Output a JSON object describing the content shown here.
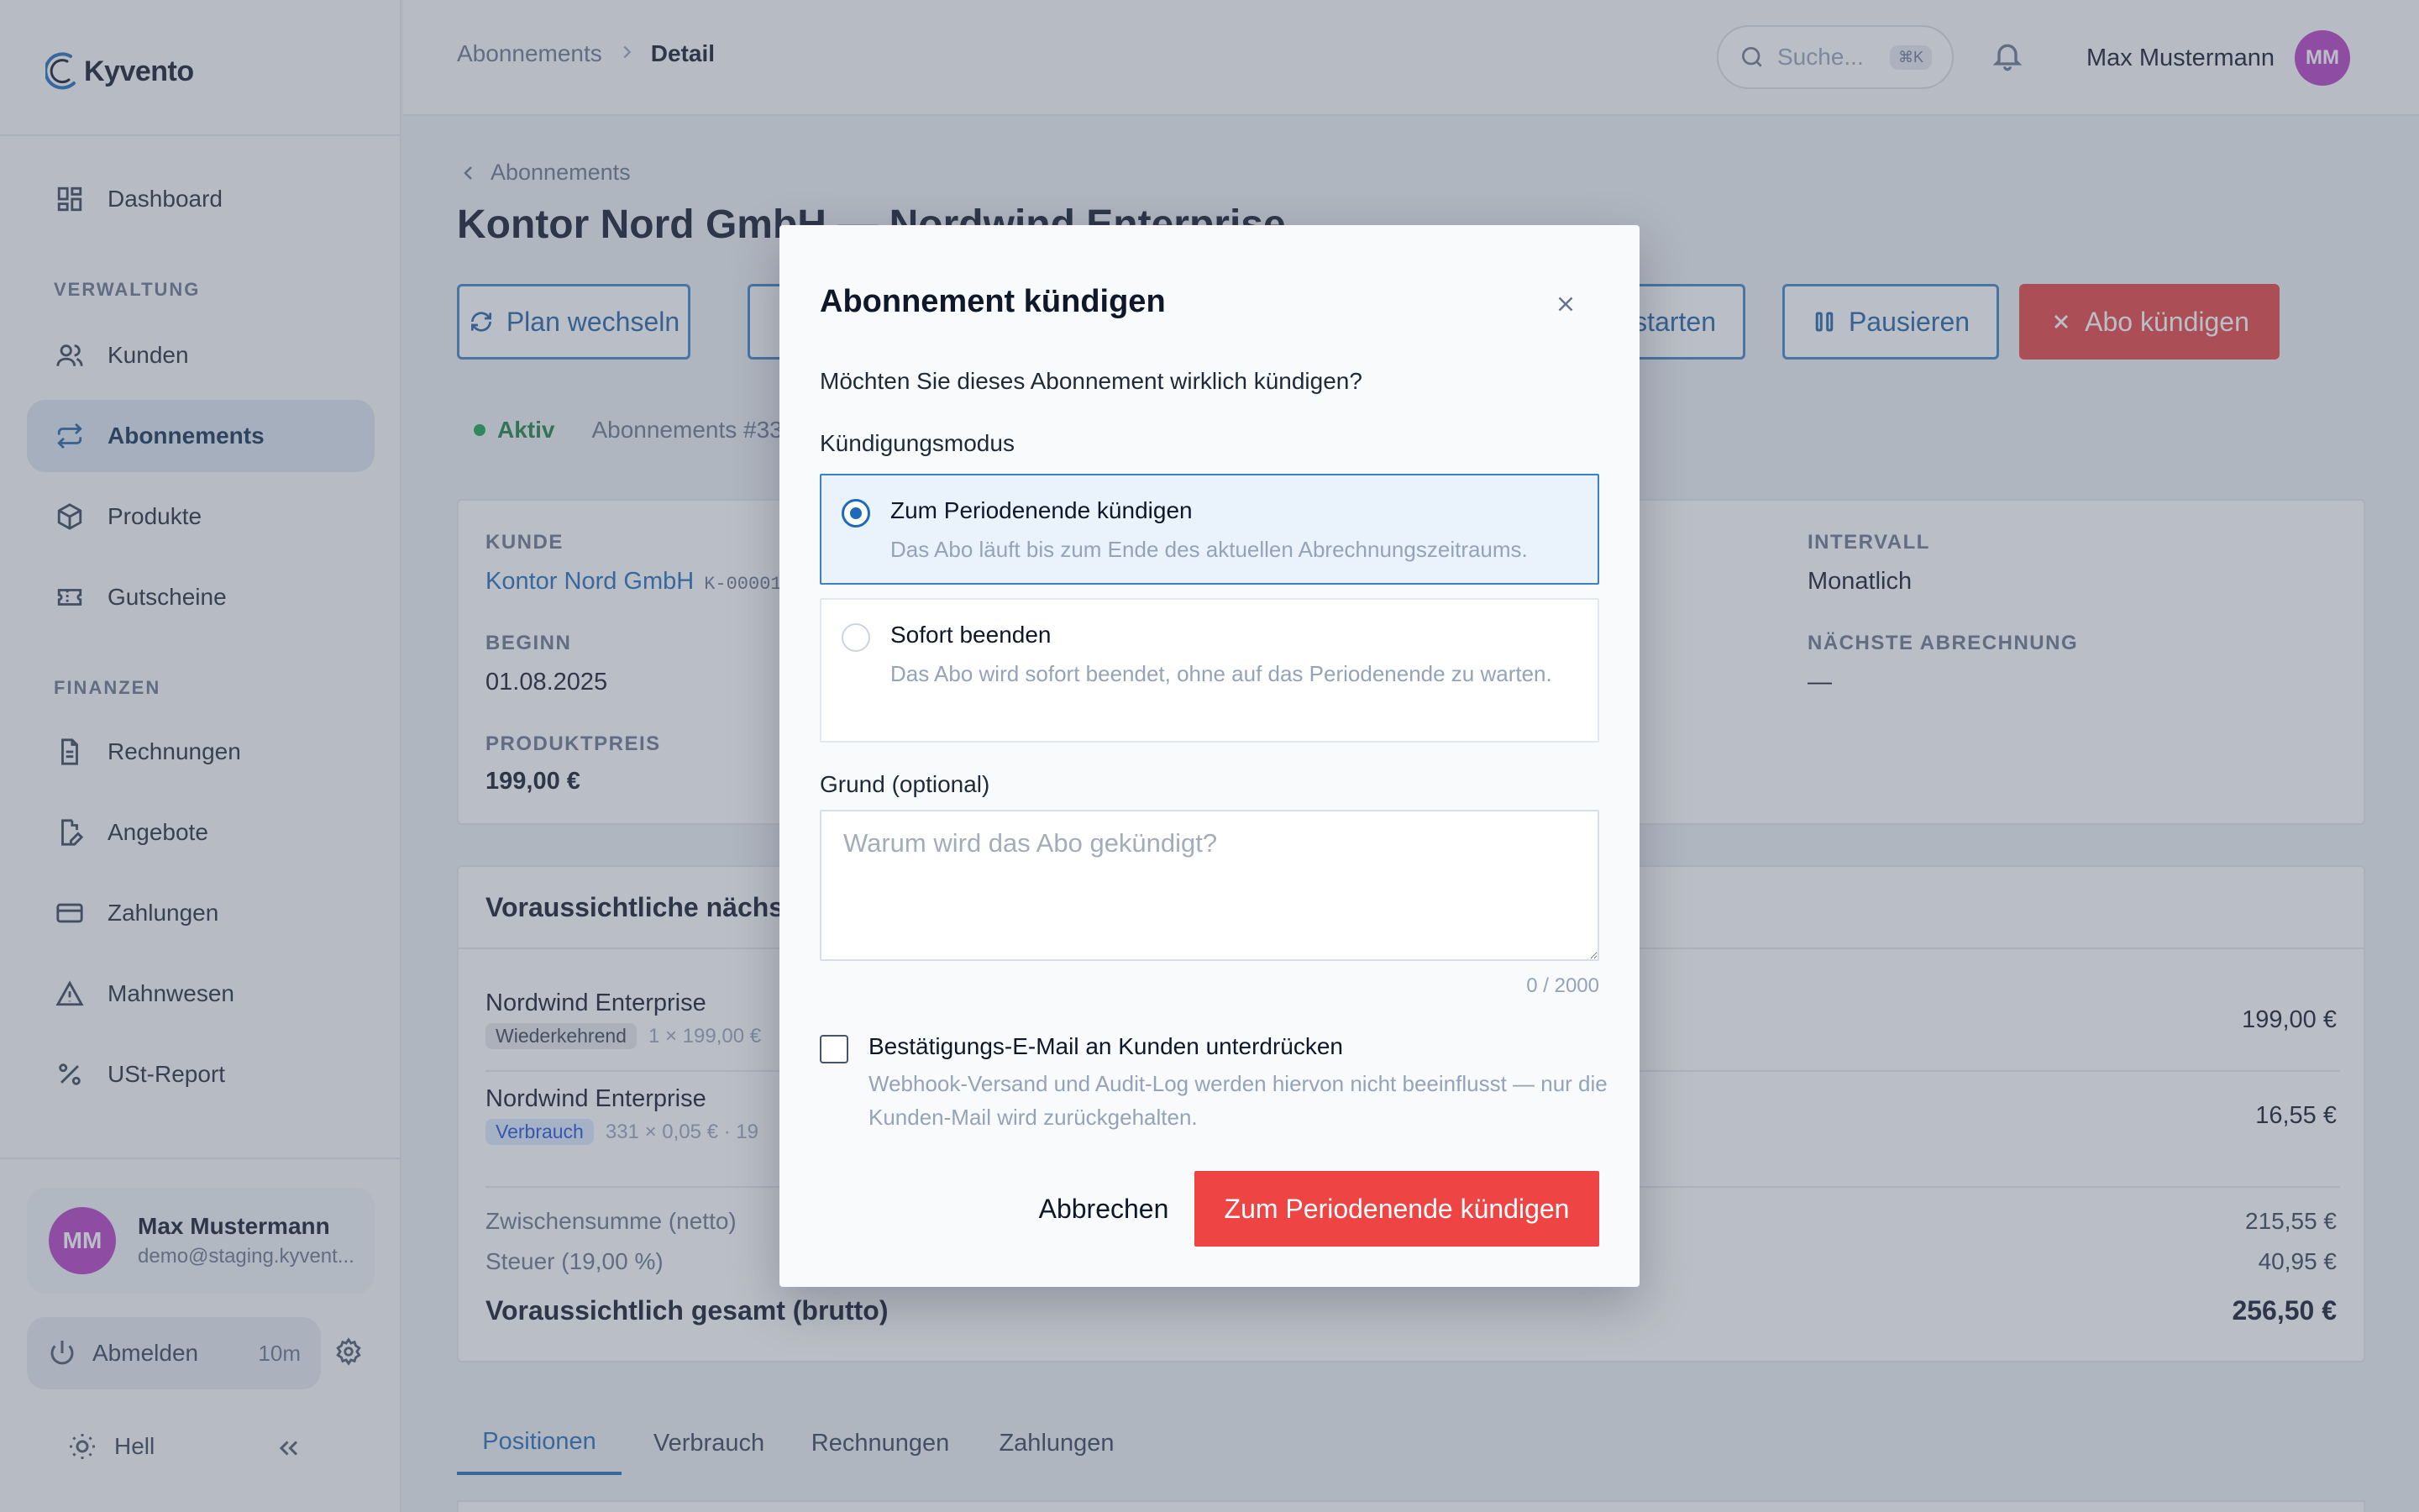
{
  "app": {
    "brand": "Kyvento",
    "colors": {
      "accent": "#1d6bb8",
      "danger": "#ef4444",
      "success": "#16a34a",
      "avatar": "#b43bc1"
    }
  },
  "sidebar": {
    "dashboard": "Dashboard",
    "section_verwaltung": "VERWALTUNG",
    "items_verwaltung": [
      {
        "label": "Kunden",
        "icon": "users-icon"
      },
      {
        "label": "Abonnements",
        "icon": "repeat-icon",
        "active": true
      },
      {
        "label": "Produkte",
        "icon": "box-icon"
      },
      {
        "label": "Gutscheine",
        "icon": "ticket-icon"
      }
    ],
    "section_finanzen": "FINANZEN",
    "items_finanzen": [
      {
        "label": "Rechnungen",
        "icon": "file-text-icon"
      },
      {
        "label": "Angebote",
        "icon": "file-edit-icon"
      },
      {
        "label": "Zahlungen",
        "icon": "credit-card-icon"
      },
      {
        "label": "Mahnwesen",
        "icon": "alert-triangle-icon"
      },
      {
        "label": "USt-Report",
        "icon": "percent-icon"
      }
    ],
    "user": {
      "initials": "MM",
      "name": "Max Mustermann",
      "email": "demo@staging.kyvent..."
    },
    "logout": {
      "label": "Abmelden",
      "time": "10m"
    },
    "theme": "Hell"
  },
  "topbar": {
    "breadcrumb": {
      "parent": "Abonnements",
      "current": "Detail"
    },
    "search": {
      "placeholder": "Suche...",
      "shortcut": "⌘K"
    },
    "user": {
      "name": "Max Mustermann",
      "initials": "MM"
    }
  },
  "main": {
    "back_label": "Abonnements",
    "title": "Kontor Nord GmbH — Nordwind Enterprise",
    "actions": {
      "plan_change": "Plan wechseln",
      "start": "starten",
      "pause": "Pausieren",
      "cancel": "Abo kündigen"
    },
    "status": {
      "label": "Aktiv",
      "id": "Abonnements #33"
    },
    "details": {
      "customer_label": "KUNDE",
      "customer_name": "Kontor Nord GmbH",
      "customer_id": "K-00001",
      "start_label": "BEGINN",
      "start_value": "01.08.2025",
      "price_label": "PRODUKTPREIS",
      "price_value": "199,00 €",
      "interval_label": "INTERVALL",
      "interval_value": "Monatlich",
      "next_billing_label": "NÄCHSTE ABRECHNUNG",
      "next_billing_value": "—"
    },
    "invoice_preview": {
      "heading": "Voraussichtliche nächst",
      "positions": [
        {
          "name": "Nordwind Enterprise",
          "tag": "Wiederkehrend",
          "meta": "1 × 199,00 €",
          "amount": "199,00 €"
        },
        {
          "name": "Nordwind Enterprise",
          "tag": "Verbrauch",
          "meta": "331 × 0,05 €  ·  19",
          "amount": "16,55 €"
        }
      ],
      "subtotal_label": "Zwischensumme (netto)",
      "subtotal_value": "215,55 €",
      "tax_label": "Steuer (19,00 %)",
      "tax_value": "40,95 €",
      "total_label": "Voraussichtlich gesamt (brutto)",
      "total_value": "256,50 €"
    },
    "tabs": [
      "Positionen",
      "Verbrauch",
      "Rechnungen",
      "Zahlungen"
    ]
  },
  "modal": {
    "title": "Abonnement kündigen",
    "question": "Möchten Sie dieses Abonnement wirklich kündigen?",
    "mode_label": "Kündigungsmodus",
    "option_period": {
      "title": "Zum Periodenende kündigen",
      "desc": "Das Abo läuft bis zum Ende des aktuellen Abrechnungszeitraums.",
      "selected": true
    },
    "option_immediate": {
      "title": "Sofort beenden",
      "desc": "Das Abo wird sofort beendet, ohne auf das Periodenende zu warten.",
      "selected": false
    },
    "reason_label": "Grund (optional)",
    "reason_placeholder": "Warum wird das Abo gekündigt?",
    "reason_value": "",
    "counter": "0 / 2000",
    "suppress_email": {
      "title": "Bestätigungs-E-Mail an Kunden unterdrücken",
      "desc": "Webhook-Versand und Audit-Log werden hiervon nicht beeinflusst — nur die Kunden-Mail wird zurückgehalten.",
      "checked": false
    },
    "cancel_label": "Abbrechen",
    "confirm_label": "Zum Periodenende kündigen"
  }
}
